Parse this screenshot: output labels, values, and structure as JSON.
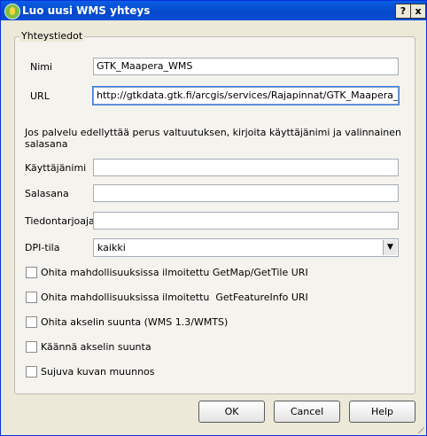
{
  "window": {
    "title": "Luo uusi WMS yhteys",
    "help_btn": "?",
    "close_btn": "x"
  },
  "group": {
    "legend": "Yhteystiedot"
  },
  "fields": {
    "name": {
      "label": "Nimi",
      "value": "GTK_Maapera_WMS"
    },
    "url": {
      "label": "URL",
      "value": "http://gtkdata.gtk.fi/arcgis/services/Rajapinnat/GTK_Maapera_WMS/M"
    },
    "auth_note": "Jos palvelu edellyttää perus valtuutuksen, kirjoita käyttäjänimi ja valinnainen salasana",
    "username": {
      "label": "Käyttäjänimi",
      "value": ""
    },
    "password": {
      "label": "Salasana",
      "value": ""
    },
    "referer": {
      "label": "Tiedontarjoaja",
      "value": ""
    },
    "dpi": {
      "label": "DPI-tila",
      "value": "kaikki"
    }
  },
  "checkboxes": [
    {
      "label": "Ohita mahdollisuuksissa ilmoitettu GetMap/GetTile URI",
      "checked": false
    },
    {
      "label": "Ohita mahdollisuuksissa ilmoitettu  GetFeatureInfo URI",
      "checked": false
    },
    {
      "label": "Ohita akselin suunta (WMS 1.3/WMTS)",
      "checked": false
    },
    {
      "label": "Käännä akselin suunta",
      "checked": false
    },
    {
      "label": "Sujuva kuvan muunnos",
      "checked": false
    }
  ],
  "buttons": {
    "ok": "OK",
    "cancel": "Cancel",
    "help": "Help"
  }
}
